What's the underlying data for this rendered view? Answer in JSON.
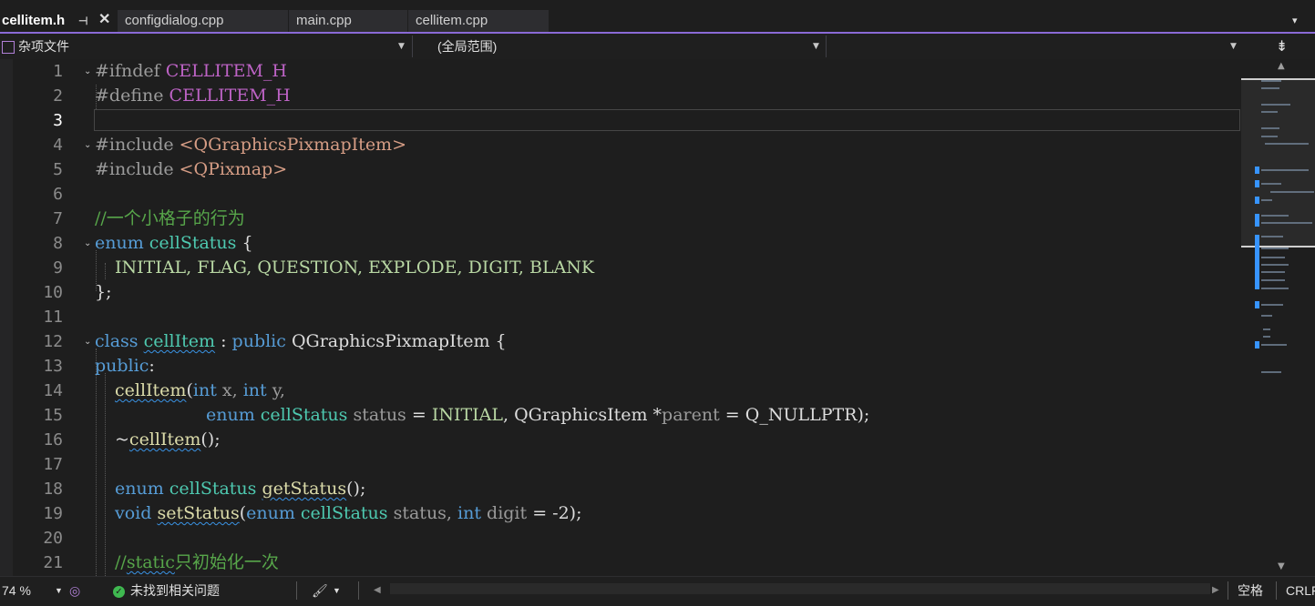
{
  "tabs": [
    {
      "label": "cellitem.h",
      "active": true
    },
    {
      "label": "configdialog.cpp",
      "active": false
    },
    {
      "label": "main.cpp",
      "active": false
    },
    {
      "label": "cellitem.cpp",
      "active": false
    }
  ],
  "tab_icons": {
    "pin": "⊣",
    "close": "✕",
    "overflow": "▾"
  },
  "navbar": {
    "project": "杂项文件",
    "scope": "(全局范围)",
    "member": ""
  },
  "code_lines": [
    {
      "n": "1"
    },
    {
      "n": "2"
    },
    {
      "n": "3"
    },
    {
      "n": "4"
    },
    {
      "n": "5"
    },
    {
      "n": "6"
    },
    {
      "n": "7"
    },
    {
      "n": "8"
    },
    {
      "n": "9"
    },
    {
      "n": "10"
    },
    {
      "n": "11"
    },
    {
      "n": "12"
    },
    {
      "n": "13"
    },
    {
      "n": "14"
    },
    {
      "n": "15"
    },
    {
      "n": "16"
    },
    {
      "n": "17"
    },
    {
      "n": "18"
    },
    {
      "n": "19"
    },
    {
      "n": "20"
    },
    {
      "n": "21"
    }
  ],
  "code": {
    "l1": {
      "a": "#ifndef ",
      "b": "CELLITEM_H"
    },
    "l2": {
      "a": "#define ",
      "b": "CELLITEM_H"
    },
    "l4": {
      "a": "#include ",
      "b": "<QGraphicsPixmapItem>"
    },
    "l5": {
      "a": "#include ",
      "b": "<QPixmap>"
    },
    "l7": {
      "a": "//一个小格子的行为"
    },
    "l8": {
      "a": "enum",
      "b": "cellStatus",
      "c": "{"
    },
    "l9": {
      "a": "INITIAL, FLAG, QUESTION, EXPLODE, DIGIT, BLANK"
    },
    "l10": {
      "a": "};"
    },
    "l12": {
      "a": "class",
      "b": "cellItem",
      "c": ":",
      "d": "public",
      "e": "QGraphicsPixmapItem",
      "f": "{"
    },
    "l13": {
      "a": "public",
      "b": ":"
    },
    "l14": {
      "a": "cellItem",
      "b": "(",
      "c": "int",
      "d": "x,",
      "e": "int",
      "f": "y,"
    },
    "l15": {
      "a": "enum",
      "b": "cellStatus",
      "c": "status",
      "d": "= ",
      "e": "INITIAL",
      "f": ", QGraphicsItem *",
      "g": "parent",
      "h": " = Q_NULLPTR);"
    },
    "l16": {
      "a": "~",
      "b": "cellItem",
      "c": "();"
    },
    "l18": {
      "a": "enum",
      "b": "cellStatus",
      "c": "getStatus",
      "d": "();"
    },
    "l19": {
      "a": "void",
      "b": "setStatus",
      "c": "(",
      "d": "enum",
      "e": "cellStatus",
      "f": "status,",
      "g": "int",
      "h": "digit",
      "i": " = -2);"
    },
    "l21": {
      "a": "//",
      "b": "static",
      "c": "只初始化一次"
    }
  },
  "fold_icon": "⌄",
  "statusbar": {
    "zoom": "74 %",
    "issues": "未找到相关问题",
    "spaces": "空格",
    "line_ending": "CRLF"
  },
  "colors": {
    "accent": "#8a6ad6",
    "keyword": "#569cd6",
    "type": "#4ec9b0",
    "comment": "#57a64a",
    "function": "#dcdcaa",
    "string": "#d69d85",
    "macro": "#bd63c5",
    "status_ok": "#3fb950"
  }
}
